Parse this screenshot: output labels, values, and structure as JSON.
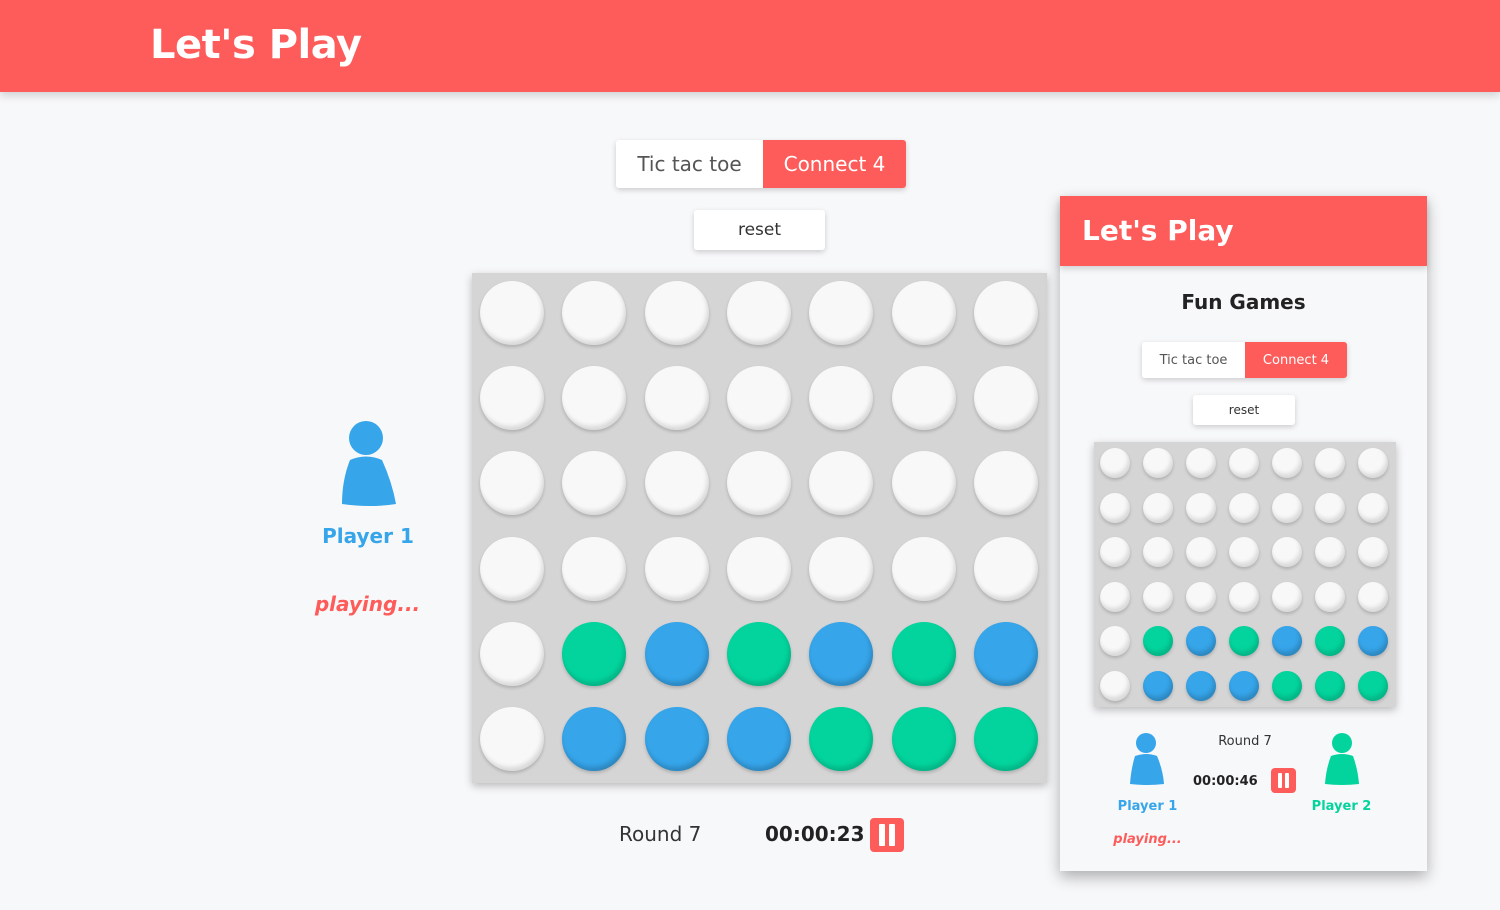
{
  "app": {
    "title": "Let's Play"
  },
  "game_selector": {
    "options": [
      "Tic tac toe",
      "Connect 4"
    ],
    "selected": "Connect 4"
  },
  "controls": {
    "reset_label": "reset"
  },
  "colors": {
    "accent": "#fd5c5a",
    "player1": "#36a5ea",
    "player2": "#03d49d",
    "board": "#d5d5d5",
    "empty_slot": "#f8f8f8"
  },
  "board": {
    "columns": 7,
    "rows": [
      [
        "empty",
        "empty",
        "empty",
        "empty",
        "empty",
        "empty",
        "empty"
      ],
      [
        "empty",
        "empty",
        "empty",
        "empty",
        "empty",
        "empty",
        "empty"
      ],
      [
        "empty",
        "empty",
        "empty",
        "empty",
        "empty",
        "empty",
        "empty"
      ],
      [
        "empty",
        "empty",
        "empty",
        "empty",
        "empty",
        "empty",
        "empty"
      ],
      [
        "empty",
        "green",
        "blue",
        "green",
        "blue",
        "green",
        "blue"
      ],
      [
        "empty",
        "blue",
        "blue",
        "blue",
        "green",
        "green",
        "green"
      ]
    ]
  },
  "player1": {
    "name": "Player 1",
    "status": "playing...",
    "icon": "person-icon"
  },
  "status_bar": {
    "round": "Round 7",
    "timer": "00:00:23",
    "pause_icon": "pause-icon"
  },
  "preview": {
    "title": "Let's Play",
    "subtitle": "Fun Games",
    "game_selector": {
      "options": [
        "Tic tac toe",
        "Connect 4"
      ],
      "selected": "Connect 4"
    },
    "reset_label": "reset",
    "board": {
      "rows": [
        [
          "empty",
          "empty",
          "empty",
          "empty",
          "empty",
          "empty",
          "empty"
        ],
        [
          "empty",
          "empty",
          "empty",
          "empty",
          "empty",
          "empty",
          "empty"
        ],
        [
          "empty",
          "empty",
          "empty",
          "empty",
          "empty",
          "empty",
          "empty"
        ],
        [
          "empty",
          "empty",
          "empty",
          "empty",
          "empty",
          "empty",
          "empty"
        ],
        [
          "empty",
          "green",
          "blue",
          "green",
          "blue",
          "green",
          "blue"
        ],
        [
          "empty",
          "blue",
          "blue",
          "blue",
          "green",
          "green",
          "green"
        ]
      ]
    },
    "player1": {
      "name": "Player 1",
      "status": "playing..."
    },
    "player2": {
      "name": "Player 2"
    },
    "round": "Round 7",
    "timer": "00:00:46"
  }
}
